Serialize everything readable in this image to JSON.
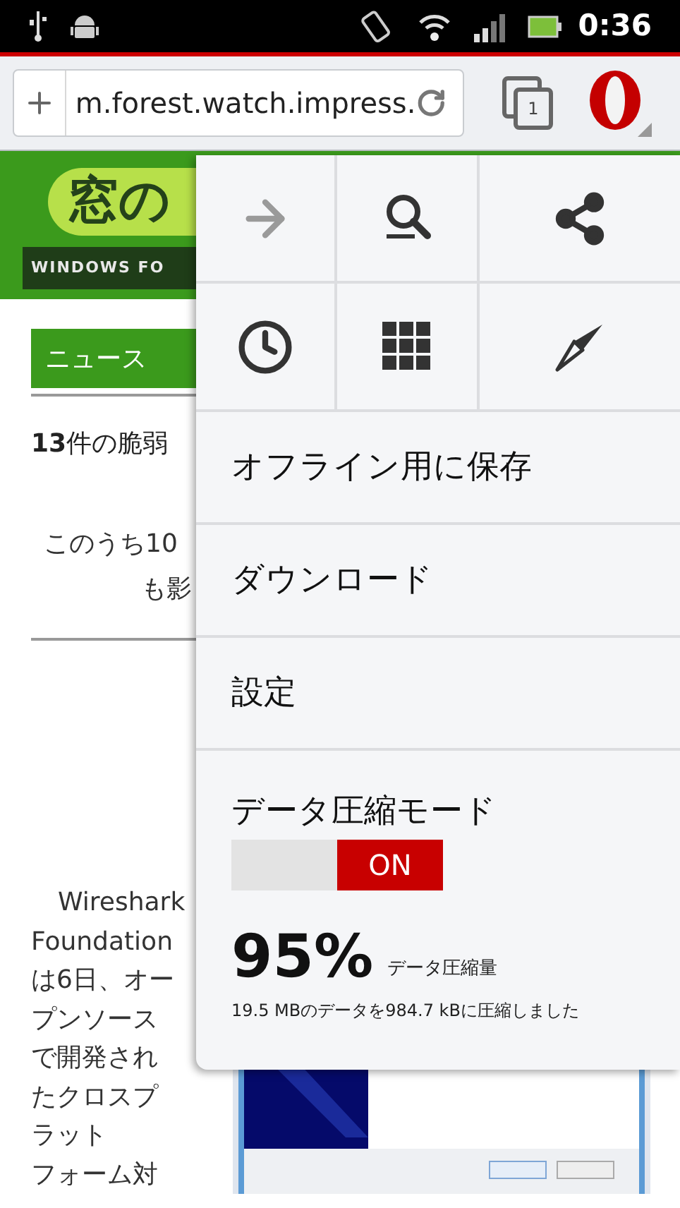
{
  "status_bar": {
    "time": "0:36"
  },
  "toolbar": {
    "url": "m.forest.watch.impress.",
    "tab_count": "1"
  },
  "page": {
    "logo_text": "窓の",
    "logo_subtitle": "WINDOWS FO",
    "section": "ニュース",
    "headline": "**13**件の脆弱",
    "summary_lines": [
      "このうち10",
      "も影"
    ],
    "paragraph_lines": [
      "Wireshark",
      "Foundation",
      "は6日、オー",
      "プンソース",
      "で開発され",
      "たクロスプ",
      "ラット",
      "フォーム対"
    ]
  },
  "menu": {
    "quick_actions": [
      {
        "kind": "forward",
        "disabled": true
      },
      {
        "kind": "find",
        "disabled": false
      },
      {
        "kind": "share",
        "disabled": false
      },
      {
        "kind": "history",
        "disabled": false
      },
      {
        "kind": "speed_dial",
        "disabled": false
      },
      {
        "kind": "discover",
        "disabled": false
      }
    ],
    "items": [
      "オフライン用に保存",
      "ダウンロード",
      "設定"
    ],
    "compression": {
      "label": "データ圧縮モード",
      "on": true,
      "state_label": "ON",
      "percent": "95%",
      "percent_label": "データ圧縮量",
      "detail": "19.5 MBのデータを984.7 kBに圧縮しました"
    }
  }
}
